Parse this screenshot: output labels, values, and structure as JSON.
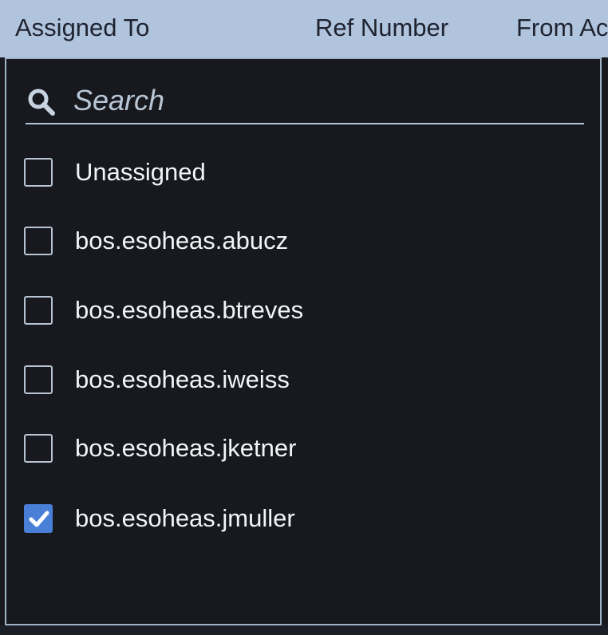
{
  "header": {
    "columns": [
      {
        "label": "Assigned To"
      },
      {
        "label": "Ref Number"
      },
      {
        "label": "From Ac"
      }
    ]
  },
  "filter": {
    "search_placeholder": "Search",
    "search_value": "",
    "options": [
      {
        "label": "Unassigned",
        "checked": false
      },
      {
        "label": "bos.esoheas.abucz",
        "checked": false
      },
      {
        "label": "bos.esoheas.btreves",
        "checked": false
      },
      {
        "label": "bos.esoheas.iweiss",
        "checked": false
      },
      {
        "label": "bos.esoheas.jketner",
        "checked": false
      },
      {
        "label": "bos.esoheas.jmuller",
        "checked": true
      }
    ]
  },
  "colors": {
    "header_bg": "#b0c4de",
    "panel_bg": "#17191e",
    "checkbox_checked": "#4a7fd8"
  },
  "icons": {
    "search": "search-icon",
    "check": "checkmark-icon"
  }
}
